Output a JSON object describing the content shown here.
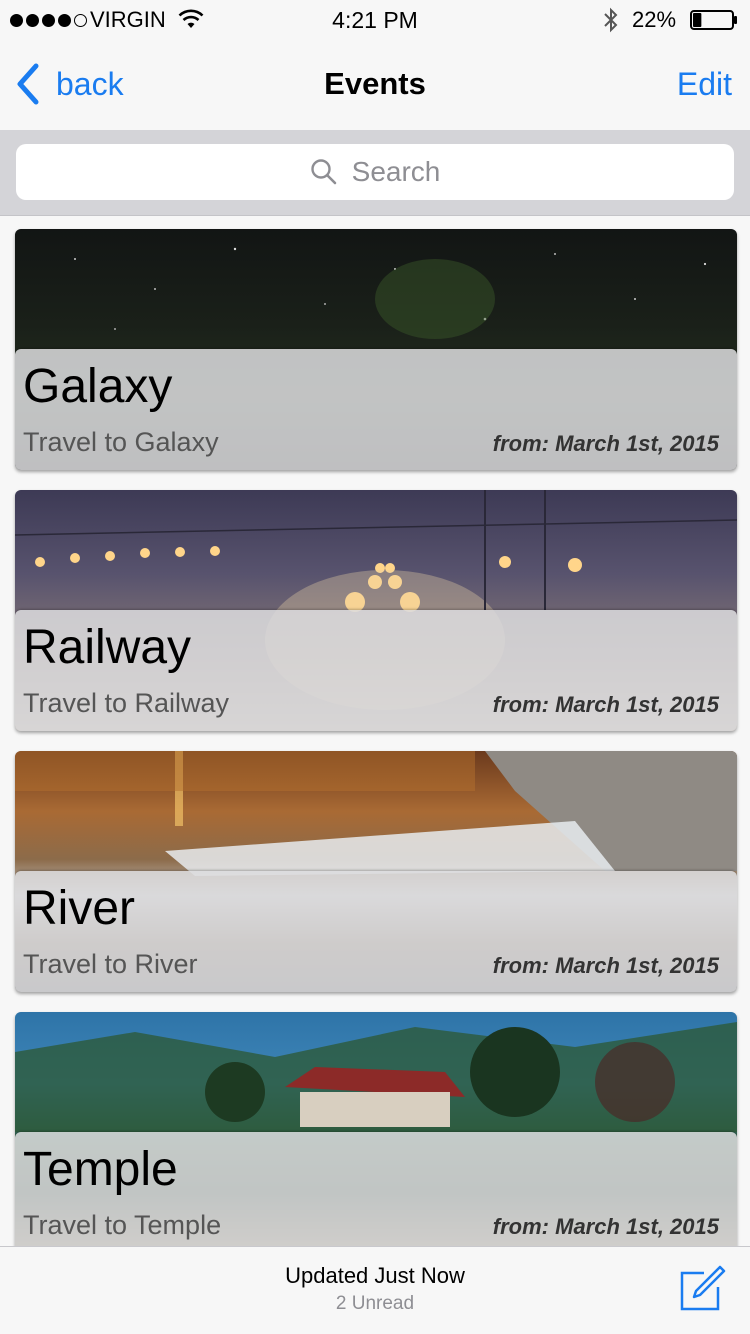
{
  "status_bar": {
    "carrier": "VIRGIN",
    "time": "4:21 PM",
    "battery_percent": "22%",
    "battery_level": 0.22,
    "signal_bars_filled": 4,
    "signal_bars_total": 5
  },
  "nav": {
    "back_label": "back",
    "title": "Events",
    "edit_label": "Edit"
  },
  "search": {
    "placeholder": "Search"
  },
  "events": [
    {
      "title": "Galaxy",
      "subtitle": "Travel to Galaxy",
      "date": "from: March 1st, 2015"
    },
    {
      "title": "Railway",
      "subtitle": "Travel to Railway",
      "date": "from: March 1st, 2015"
    },
    {
      "title": "River",
      "subtitle": "Travel to River",
      "date": "from: March 1st, 2015"
    },
    {
      "title": "Temple",
      "subtitle": "Travel to Temple",
      "date": "from: March 1st, 2015"
    }
  ],
  "toolbar": {
    "status": "Updated Just Now",
    "unread": "2 Unread"
  },
  "colors": {
    "accent": "#1a7cf0"
  }
}
